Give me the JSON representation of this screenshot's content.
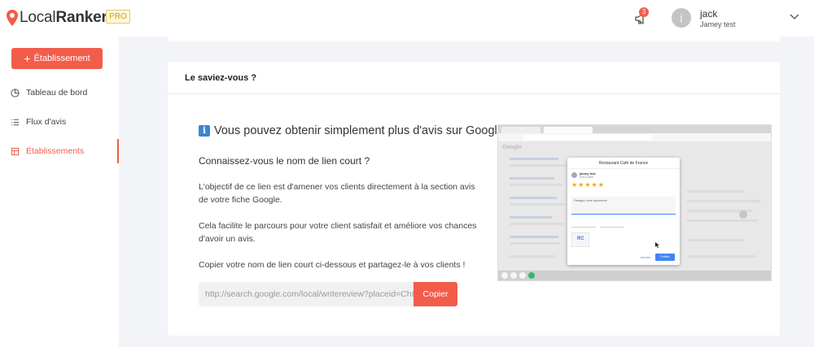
{
  "brand": {
    "name_light": "Local",
    "name_bold": "Ranker",
    "badge": "PRO",
    "accent": "#f25c4a"
  },
  "header": {
    "notifications_count": "3",
    "user": {
      "initial": "j",
      "name": "jack",
      "sub": "Jamey test"
    }
  },
  "sidebar": {
    "add_button": "Établissement",
    "items": [
      {
        "label": "Tableau de bord",
        "icon": "chart-pie-icon",
        "active": false
      },
      {
        "label": "Flux d'avis",
        "icon": "list-icon",
        "active": false
      },
      {
        "label": "Établissements",
        "icon": "building-icon",
        "active": true
      }
    ]
  },
  "card": {
    "header": "Le saviez-vous ?",
    "info_title": "Vous pouvez obtenir simplement plus d'avis sur Google.",
    "question": "Connaissez-vous le nom de lien court ?",
    "paragraph1": "L'objectif de ce lien est d'amener vos clients directement à la section avis de votre fiche Google.",
    "paragraph2": "Cela facilite le parcours pour votre client satisfait et améliore vos chances d'avoir un avis.",
    "paragraph3": "Copier votre nom de lien court ci-dessous et partagez-le à vos clients !",
    "link_value": "http://search.google.com/local/writereview?placeid=ChIJ",
    "copy_button": "Copier"
  },
  "illustration": {
    "logo": "Google",
    "dialog_title": "Restaurant Café de France",
    "reviewer": "jamey test",
    "reviewer_sub": "Avis publié",
    "stars": "★★★★★",
    "textarea_placeholder": "Partagez votre expérience",
    "thumb_label": "RC",
    "cancel": "Annuler",
    "post": "Publier"
  }
}
